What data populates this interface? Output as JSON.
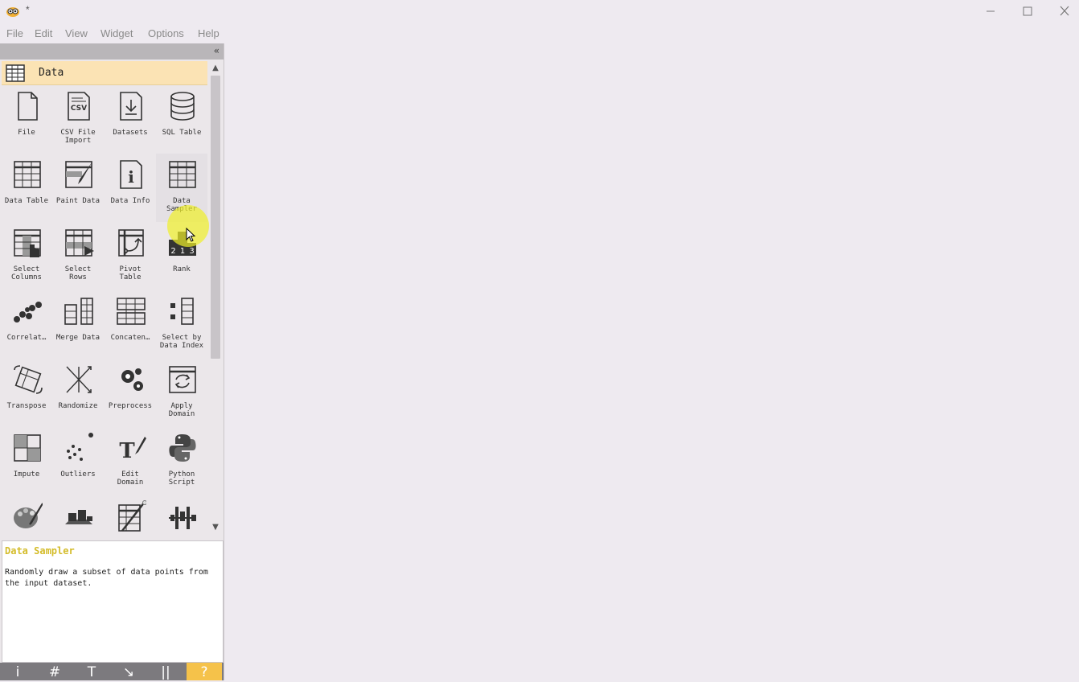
{
  "window": {
    "title": "*",
    "minimize": "–",
    "maximize": "☐",
    "close": "✕"
  },
  "menu": [
    "File",
    "Edit",
    "View",
    "Widget",
    "Options",
    "Help"
  ],
  "dock": {
    "collapse_glyph": "«",
    "category": "Data",
    "widgets": [
      {
        "label": "File",
        "icon": "file-icon"
      },
      {
        "label": "CSV File\nImport",
        "icon": "csv-icon"
      },
      {
        "label": "Datasets",
        "icon": "datasets-icon"
      },
      {
        "label": "SQL Table",
        "icon": "database-icon"
      },
      {
        "label": "Data Table",
        "icon": "table-icon"
      },
      {
        "label": "Paint Data",
        "icon": "paint-data-icon"
      },
      {
        "label": "Data Info",
        "icon": "info-icon"
      },
      {
        "label": "Data\nSampler",
        "icon": "data-sampler-icon"
      },
      {
        "label": "Select\nColumns",
        "icon": "select-columns-icon"
      },
      {
        "label": "Select\nRows",
        "icon": "select-rows-icon"
      },
      {
        "label": "Pivot\nTable",
        "icon": "pivot-table-icon"
      },
      {
        "label": "Rank",
        "icon": "rank-icon"
      },
      {
        "label": "Correlat…",
        "icon": "correlations-icon"
      },
      {
        "label": "Merge Data",
        "icon": "merge-data-icon"
      },
      {
        "label": "Concaten…",
        "icon": "concatenate-icon"
      },
      {
        "label": "Select by\nData Index",
        "icon": "select-by-index-icon"
      },
      {
        "label": "Transpose",
        "icon": "transpose-icon"
      },
      {
        "label": "Randomize",
        "icon": "randomize-icon"
      },
      {
        "label": "Preprocess",
        "icon": "preprocess-icon"
      },
      {
        "label": "Apply\nDomain",
        "icon": "apply-domain-icon"
      },
      {
        "label": "Impute",
        "icon": "impute-icon"
      },
      {
        "label": "Outliers",
        "icon": "outliers-icon"
      },
      {
        "label": "Edit\nDomain",
        "icon": "edit-domain-icon"
      },
      {
        "label": "Python\nScript",
        "icon": "python-icon"
      },
      {
        "label": "",
        "icon": "color-icon"
      },
      {
        "label": "",
        "icon": "continuize-icon"
      },
      {
        "label": "",
        "icon": "create-class-icon"
      },
      {
        "label": "",
        "icon": "discretize-icon"
      }
    ],
    "hovered_widget": "Data Sampler",
    "description": {
      "title": "Data Sampler",
      "text": "Randomly draw a subset of data points from the input dataset."
    },
    "toolbar": [
      {
        "glyph": "i",
        "icon": "info-toolbar-icon"
      },
      {
        "glyph": "#",
        "icon": "grid-toolbar-icon"
      },
      {
        "glyph": "T",
        "icon": "text-annotation-icon"
      },
      {
        "glyph": "↘",
        "icon": "arrow-annotation-icon"
      },
      {
        "glyph": "||",
        "icon": "pause-icon"
      },
      {
        "glyph": "?",
        "icon": "help-icon"
      }
    ]
  }
}
